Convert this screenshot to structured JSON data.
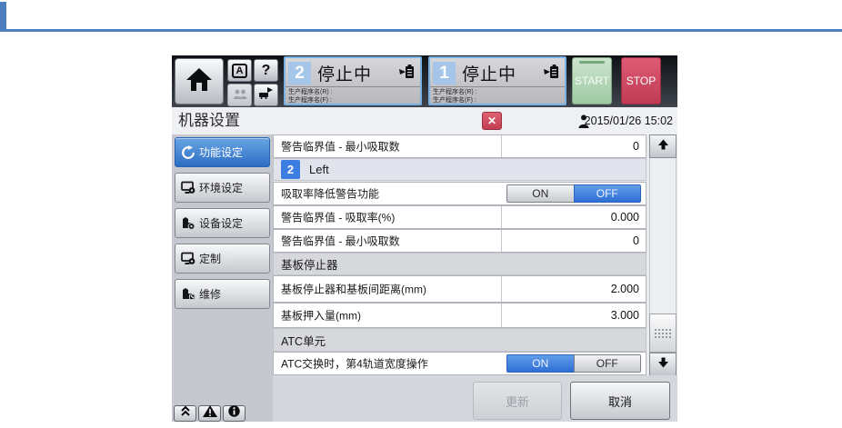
{
  "colors": {
    "accent_blue": "#3c7de2",
    "decor_blue": "#4d7ebf",
    "start_green": "#9ecaa3",
    "stop_red": "#c03a55",
    "close_red": "#c23c50",
    "lane_border_blue": "#79b1e4"
  },
  "top_bar": {
    "start_label": "START",
    "stop_label": "STOP",
    "lanes": [
      {
        "number": "2",
        "status": "停止中",
        "program_r": "生产程序名(R) :",
        "program_f": "生产程序名(F) :"
      },
      {
        "number": "1",
        "status": "停止中",
        "program_r": "生产程序名(R) :",
        "program_f": "生产程序名(F) :"
      }
    ],
    "language_button_glyph": "A",
    "help_button_glyph": "?"
  },
  "title_bar": {
    "title": "机器设置",
    "close_glyph": "✕",
    "timestamp": "2015/01/26 15:02"
  },
  "sidebar": {
    "items": [
      {
        "label": "功能设定",
        "selected": true
      },
      {
        "label": "环境设定",
        "selected": false
      },
      {
        "label": "设备设定",
        "selected": false
      },
      {
        "label": "定制",
        "selected": false
      },
      {
        "label": "维修",
        "selected": false
      }
    ]
  },
  "table": {
    "rows": [
      {
        "type": "field",
        "label": "警告临界值 - 最小吸取数",
        "value": "0"
      },
      {
        "type": "section_lane",
        "badge": "2",
        "label": "Left"
      },
      {
        "type": "field_toggle",
        "label": "吸取率降低警告功能",
        "on": "ON",
        "off": "OFF",
        "selected": "OFF"
      },
      {
        "type": "field",
        "label": "警告临界值 - 吸取率(%)",
        "value": "0.000"
      },
      {
        "type": "field",
        "label": "警告临界值 - 最小吸取数",
        "value": "0"
      },
      {
        "type": "section",
        "label": "基板停止器"
      },
      {
        "type": "field",
        "label": "基板停止器和基板间距离(mm)",
        "value": "2.000"
      },
      {
        "type": "field",
        "label": "基板押入量(mm)",
        "value": "3.000"
      },
      {
        "type": "section",
        "label": "ATC单元"
      },
      {
        "type": "field_toggle",
        "label": "ATC交换时，第4轨道宽度操作",
        "on": "ON",
        "off": "OFF",
        "selected": "ON"
      }
    ]
  },
  "footer": {
    "update_label": "更新",
    "cancel_label": "取消"
  }
}
